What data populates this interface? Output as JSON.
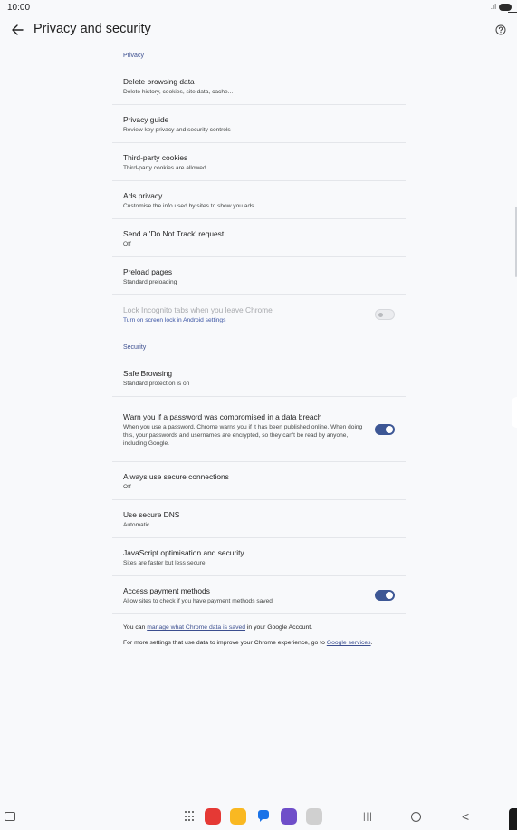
{
  "status": {
    "time": "10:00",
    "signal": ".ıl"
  },
  "header": {
    "title": "Privacy and security"
  },
  "sections": {
    "privacy": "Privacy",
    "security": "Security"
  },
  "privacy_items": [
    {
      "title": "Delete browsing data",
      "subtitle": "Delete history, cookies, site data, cache..."
    },
    {
      "title": "Privacy guide",
      "subtitle": "Review key privacy and security controls"
    },
    {
      "title": "Third-party cookies",
      "subtitle": "Third-party cookies are allowed"
    },
    {
      "title": "Ads privacy",
      "subtitle": "Customise the info used by sites to show you ads"
    },
    {
      "title": "Send a 'Do Not Track' request",
      "subtitle": "Off"
    },
    {
      "title": "Preload pages",
      "subtitle": "Standard preloading"
    },
    {
      "title": "Lock Incognito tabs when you leave Chrome",
      "subtitle": "Turn on screen lock in Android settings",
      "toggle": false,
      "disabled": true
    }
  ],
  "security_items": [
    {
      "title": "Safe Browsing",
      "subtitle": "Standard protection is on"
    },
    {
      "title": "Warn you if a password was compromised in a data breach",
      "subtitle": "When you use a password, Chrome warns you if it has been published online. When doing this, your passwords and usernames are encrypted, so they can't be read by anyone, including Google.",
      "toggle": true
    },
    {
      "title": "Always use secure connections",
      "subtitle": "Off"
    },
    {
      "title": "Use secure DNS",
      "subtitle": "Automatic"
    },
    {
      "title": "JavaScript optimisation and security",
      "subtitle": "Sites are faster but less secure"
    },
    {
      "title": "Access payment methods",
      "subtitle": "Allow sites to check if you have payment methods saved",
      "toggle": true
    }
  ],
  "footer": {
    "line1_prefix": "You can ",
    "line1_link": "manage what Chrome data is saved",
    "line1_suffix": " in your Google Account.",
    "line2_prefix": "For more settings that use data to improve your Chrome experience, go to ",
    "line2_link": "Google services",
    "line2_suffix": "."
  },
  "nav": {
    "recent": "|||",
    "back": "<"
  },
  "colors": {
    "accent": "#3d5795",
    "section_header": "#3b4e8f",
    "background": "#f8f9fb"
  }
}
